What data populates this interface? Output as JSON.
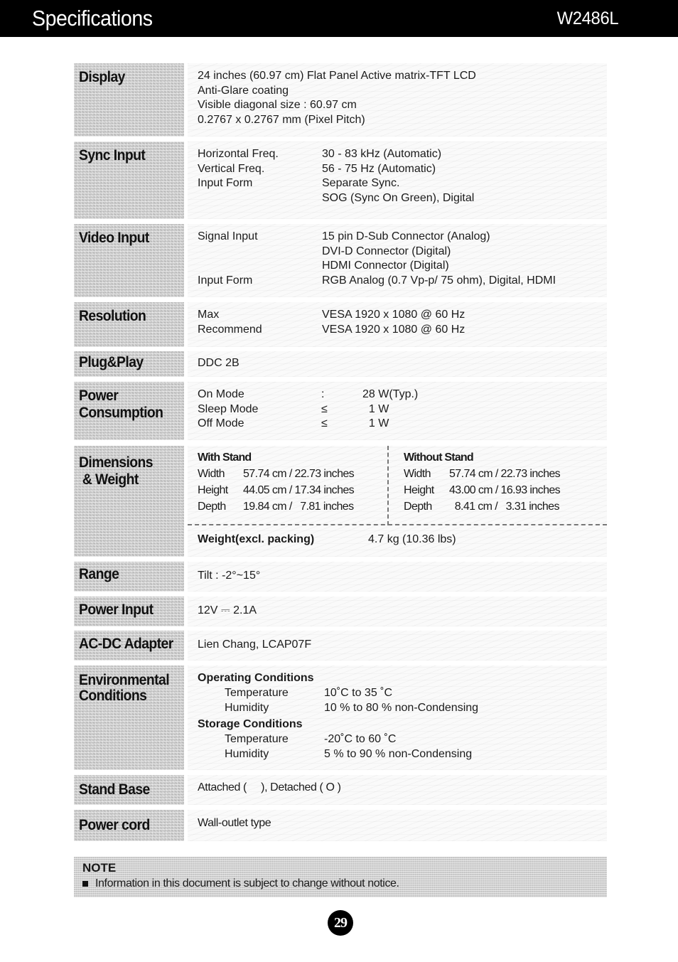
{
  "header": {
    "title": "Specifications",
    "model": "W2486L"
  },
  "sections": {
    "display": {
      "label": "Display",
      "lines": [
        "24 inches (60.97 cm) Flat Panel Active matrix-TFT LCD",
        "Anti-Glare coating",
        "Visible diagonal size : 60.97 cm",
        "0.2767 x 0.2767 mm (Pixel Pitch)"
      ]
    },
    "sync_input": {
      "label": "Sync Input",
      "rows": [
        {
          "k": "Horizontal Freq.",
          "v": "30 - 83 kHz (Automatic)"
        },
        {
          "k": "Vertical Freq.",
          "v": "56 - 75 Hz (Automatic)"
        },
        {
          "k": "Input Form",
          "v": "Separate Sync."
        },
        {
          "k": "",
          "v": "SOG (Sync On Green), Digital"
        }
      ]
    },
    "video_input": {
      "label": "Video Input",
      "rows": [
        {
          "k": "Signal Input",
          "v": "15 pin D-Sub Connector (Analog)"
        },
        {
          "k": "",
          "v": "DVI-D Connector (Digital)"
        },
        {
          "k": "",
          "v": "HDMI Connector (Digital)"
        },
        {
          "k": "Input Form",
          "v": "RGB Analog (0.7 Vp-p/ 75 ohm), Digital, HDMI"
        }
      ]
    },
    "resolution": {
      "label": "Resolution",
      "rows": [
        {
          "k": "Max",
          "v": "VESA 1920 x 1080 @ 60 Hz"
        },
        {
          "k": "Recommend",
          "v": "VESA 1920 x 1080 @ 60 Hz"
        }
      ]
    },
    "plug_play": {
      "label": "Plug&Play",
      "value": "DDC 2B"
    },
    "power_consumption": {
      "label": "Power\nConsumption",
      "rows": [
        {
          "k": "On Mode",
          "s": ":",
          "v": "28 W(Typ.)"
        },
        {
          "k": "Sleep Mode",
          "s": "≤",
          "v": "  1 W"
        },
        {
          "k": "Off Mode",
          "s": "≤",
          "v": "  1 W"
        }
      ]
    },
    "dimensions": {
      "label": "Dimensions\n & Weight",
      "with_stand": {
        "title": "With Stand",
        "rows": [
          {
            "k": "Width",
            "v": "57.74 cm / 22.73 inches"
          },
          {
            "k": "Height",
            "v": "44.05 cm / 17.34 inches"
          },
          {
            "k": "Depth",
            "v": "19.84 cm /   7.81 inches"
          }
        ]
      },
      "without_stand": {
        "title": "Without Stand",
        "rows": [
          {
            "k": "Width",
            "v": "57.74 cm / 22.73 inches"
          },
          {
            "k": "Height",
            "v": "43.00 cm / 16.93 inches"
          },
          {
            "k": "Depth",
            "v": "  8.41 cm /   3.31 inches"
          }
        ]
      },
      "weight_label": "Weight(excl. packing)",
      "weight_value": "4.7 kg (10.36 lbs)"
    },
    "range": {
      "label": "Range",
      "value": "Tilt : -2°~15°"
    },
    "power_input": {
      "label": "Power Input",
      "value": "12V ⎓ 2.1A"
    },
    "adapter": {
      "label": "AC-DC Adapter",
      "value": "Lien Chang, LCAP07F"
    },
    "environment": {
      "label": "Environmental\nConditions",
      "operating": {
        "title": "Operating Conditions",
        "rows": [
          {
            "k": "Temperature",
            "v": "10˚C to 35 ˚C"
          },
          {
            "k": "Humidity",
            "v": "10 % to 80 % non-Condensing"
          }
        ]
      },
      "storage": {
        "title": "Storage Conditions",
        "rows": [
          {
            "k": "Temperature",
            "v": "-20˚C to 60 ˚C"
          },
          {
            "k": "Humidity",
            "v": "5 % to 90 % non-Condensing"
          }
        ]
      }
    },
    "stand_base": {
      "label": "Stand Base",
      "value": "Attached (     ), Detached ( O )"
    },
    "power_cord": {
      "label": "Power cord",
      "value": "Wall-outlet type"
    }
  },
  "note": {
    "title": "NOTE",
    "item": "Information in this document is subject to change without notice."
  },
  "page_number": "29"
}
